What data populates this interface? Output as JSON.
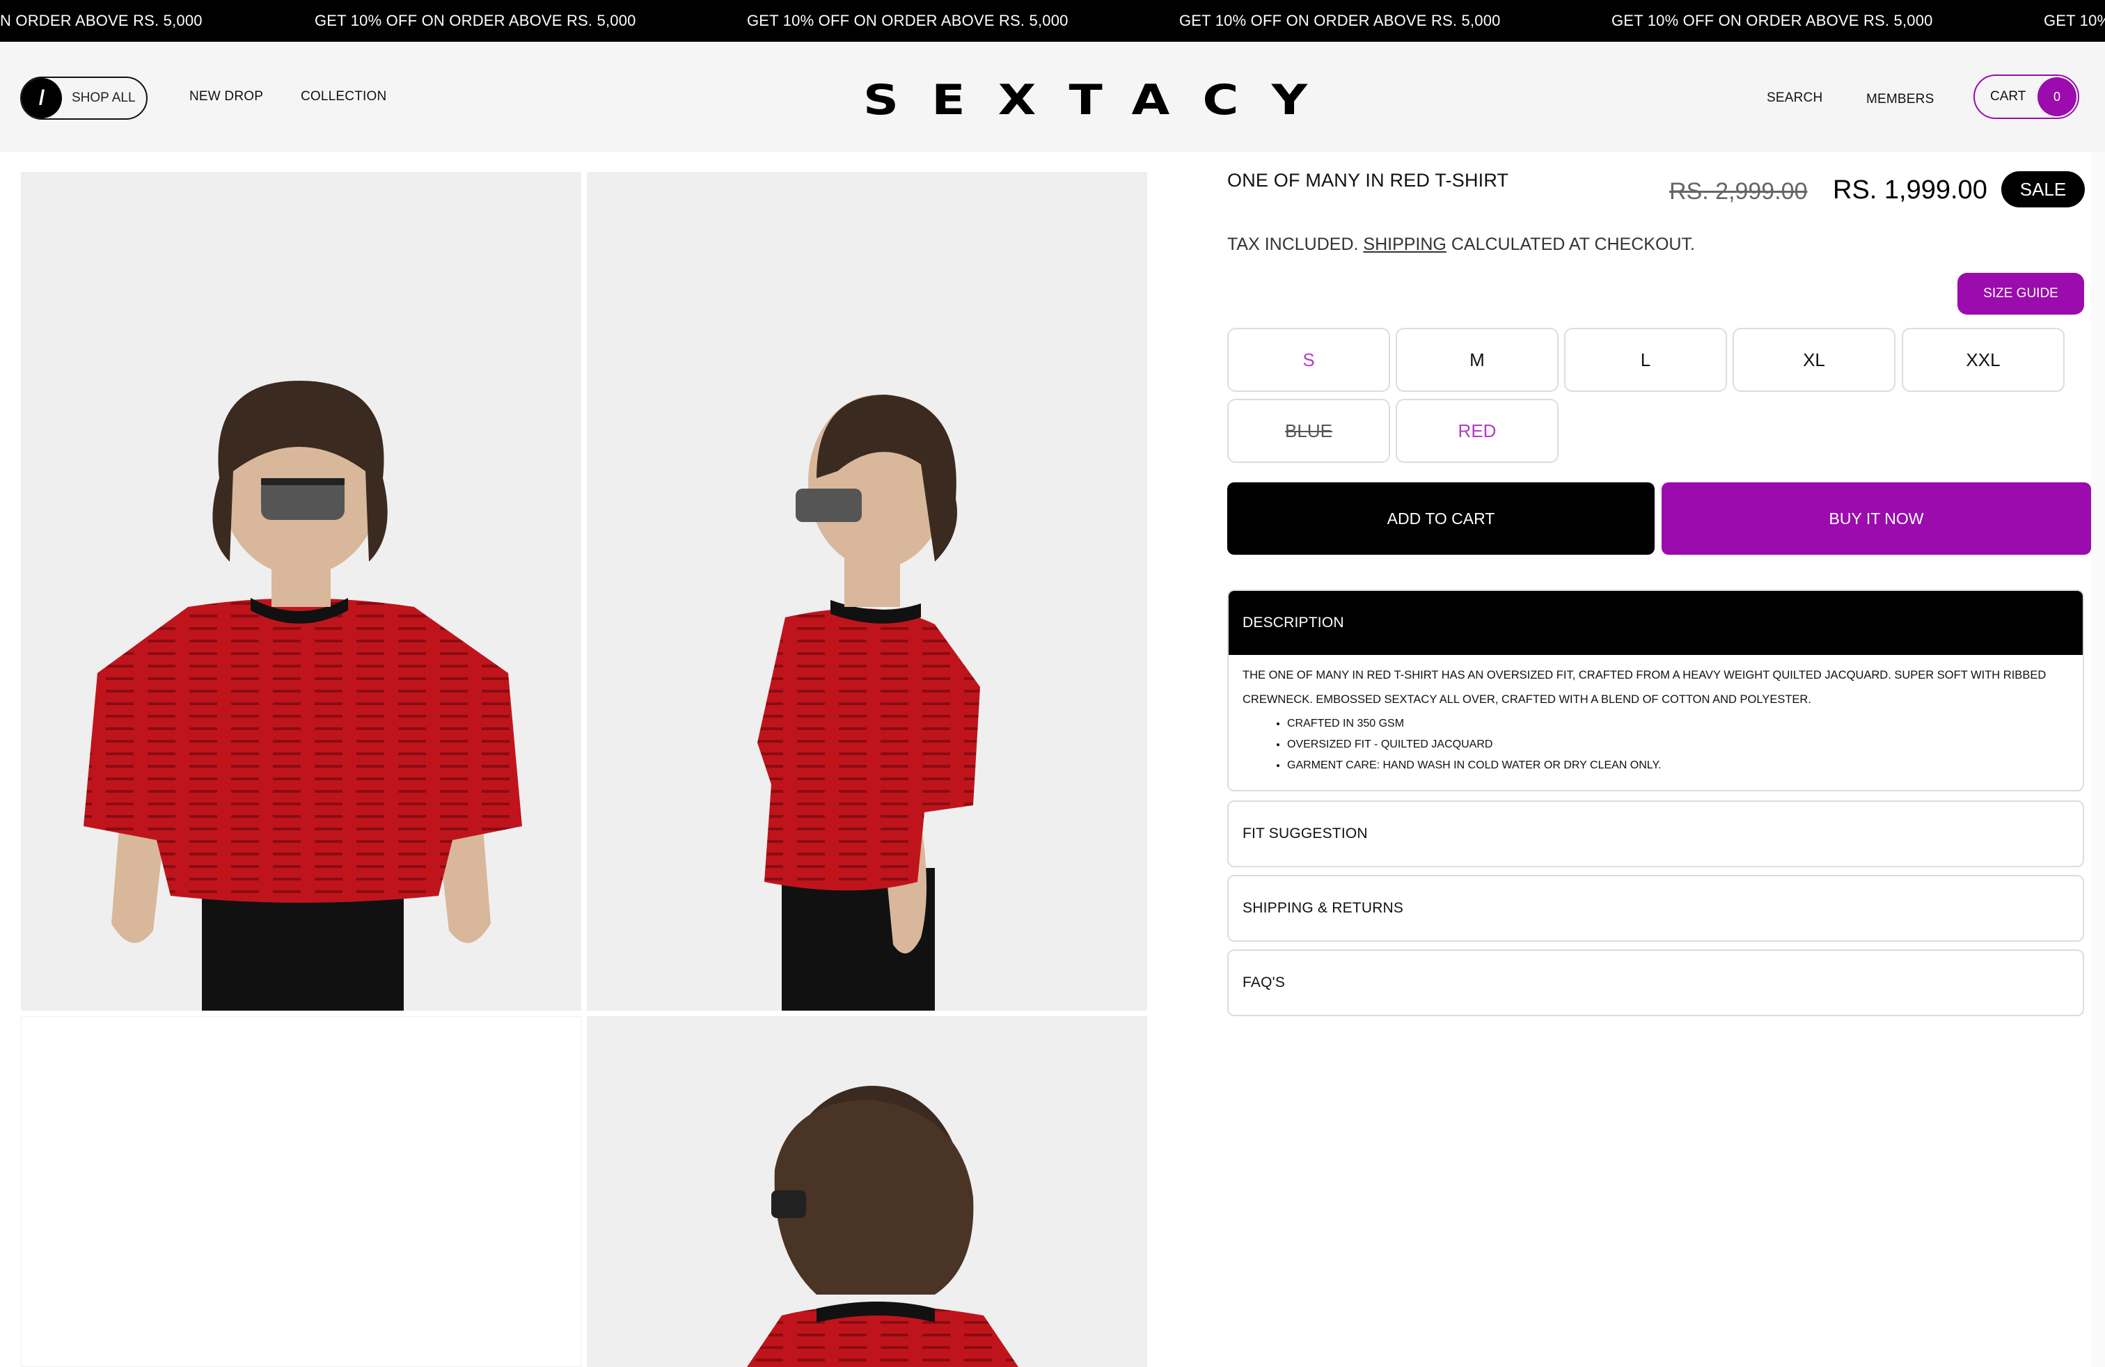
{
  "announcement": {
    "messages": [
      "N ORDER ABOVE RS. 5,000",
      "GET 10% OFF ON ORDER ABOVE RS. 5,000",
      "GET 10% OFF ON ORDER ABOVE RS. 5,000",
      "GET 10% OFF ON ORDER ABOVE RS. 5,000",
      "GET 10% OFF ON ORDER ABOVE RS. 5,000",
      "GET 10%"
    ]
  },
  "header": {
    "shop_all_label": "SHOP ALL",
    "shop_all_icon": "/",
    "nav": [
      "NEW DROP",
      "COLLECTION"
    ],
    "logo": "SEXTACY",
    "search_label": "SEARCH",
    "members_label": "MEMBERS",
    "cart_label": "CART",
    "cart_count": "0"
  },
  "product": {
    "title": "ONE OF MANY IN RED T-SHIRT",
    "price_original": "RS. 2,999.00",
    "price_sale": "RS. 1,999.00",
    "sale_badge": "SALE",
    "tax_prefix": "TAX INCLUDED. ",
    "tax_link": "SHIPPING",
    "tax_suffix": " CALCULATED AT CHECKOUT.",
    "size_guide_label": "SIZE GUIDE",
    "sizes": [
      "S",
      "M",
      "L",
      "XL",
      "XXL"
    ],
    "selected_size": "S",
    "colors": [
      "BLUE",
      "RED"
    ],
    "selected_color": "RED",
    "add_to_cart_label": "ADD TO CART",
    "buy_now_label": "BUY IT NOW",
    "accordions": {
      "description_title": "DESCRIPTION",
      "description_text": "THE ONE OF MANY IN RED T-SHIRT HAS AN OVERSIZED FIT, CRAFTED FROM A HEAVY WEIGHT QUILTED JACQUARD. SUPER SOFT WITH RIBBED CREWNECK. EMBOSSED SEXTACY ALL OVER, CRAFTED WITH A BLEND OF COTTON AND POLYESTER.",
      "description_bullets": [
        "CRAFTED IN 350 GSM",
        "OVERSIZED FIT - QUILTED JACQUARD",
        "GARMENT CARE: HAND WASH IN COLD WATER OR DRY CLEAN ONLY."
      ],
      "fit_title": "FIT SUGGESTION",
      "shipping_title": "SHIPPING & RETURNS",
      "faq_title": "FAQ'S"
    }
  },
  "colors": {
    "accent": "#9b0bae",
    "shirt_red": "#c0141c",
    "black": "#000000"
  }
}
